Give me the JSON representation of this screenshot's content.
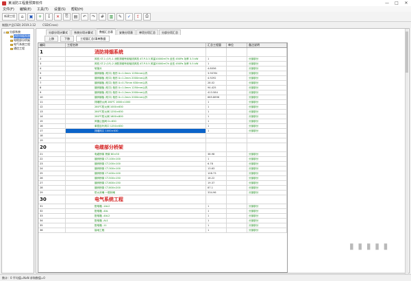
{
  "window": {
    "title": "某消防工程量预算软件",
    "controls": [
      "—",
      "□",
      "✕"
    ]
  },
  "menu": [
    "文件(F)",
    "编辑(E)",
    "工具(T)",
    "设置(S)",
    "帮助(H)"
  ],
  "toolbar": {
    "buttons": [
      {
        "name": "new-project-icon",
        "glyph": "新建工程",
        "cls": "wide"
      },
      {
        "name": "open-icon",
        "glyph": "⌂",
        "cls": ""
      },
      {
        "name": "save-icon",
        "glyph": "▣",
        "cls": "blue"
      },
      {
        "name": "add-row-icon",
        "glyph": "+",
        "cls": "green"
      },
      {
        "name": "insert-icon",
        "glyph": "↧",
        "cls": ""
      },
      {
        "name": "delete-icon",
        "glyph": "✕",
        "cls": "red"
      },
      {
        "name": "copy-icon",
        "glyph": "⎘",
        "cls": ""
      },
      {
        "name": "paste-icon",
        "glyph": "▤",
        "cls": ""
      },
      {
        "name": "undo-icon",
        "glyph": "↶",
        "cls": ""
      },
      {
        "name": "redo-icon",
        "glyph": "↷",
        "cls": ""
      },
      {
        "name": "calculator-icon",
        "glyph": "#",
        "cls": ""
      },
      {
        "name": "chart-icon",
        "glyph": "▥",
        "cls": "green"
      },
      {
        "name": "pencil-icon",
        "glyph": "✎",
        "cls": ""
      },
      {
        "name": "wrench-icon",
        "glyph": "✓",
        "cls": "blue"
      },
      {
        "name": "export-icon",
        "glyph": "⇪",
        "cls": "red"
      },
      {
        "name": "print-icon",
        "glyph": "⎙",
        "cls": ""
      }
    ]
  },
  "infobar": {
    "left": "制图(产品CSD) 2019.3.12",
    "right": "CSD(Cross)"
  },
  "sidebar": {
    "items": [
      {
        "label": "分部系统",
        "level": 0,
        "twist": "⊟",
        "selected": false
      },
      {
        "label": "消防排烟系统",
        "level": 1,
        "twist": "",
        "selected": true
      },
      {
        "label": "电缆部分桥架",
        "level": 1,
        "twist": "",
        "selected": false
      },
      {
        "label": "电气系统工程",
        "level": 1,
        "twist": "",
        "selected": false
      },
      {
        "label": "通信工程",
        "level": 1,
        "twist": "",
        "selected": false
      }
    ]
  },
  "tabs": [
    "分部分项计算式",
    "系统分项计算式",
    "数据汇总表",
    "安装分项表",
    "单项分项汇总",
    "分部分项汇总"
  ],
  "active_tab": 2,
  "subtabs": [
    "上移",
    "下移",
    "工程量汇总/清单数据"
  ],
  "grid": {
    "columns": [
      "编码",
      "工程名称",
      "汇总工程量",
      "单位",
      "备注说明"
    ],
    "rows": [
      {
        "type": "sec",
        "no": "1",
        "name": "消防排烟系统",
        "qty": "",
        "unit": "",
        "note": ""
      },
      {
        "type": "item",
        "no": "2",
        "name": "风机 ST-1 (1F)-1 消防排烟专用轴流风机 4T-P-3.3 风量10000m³/h 全压 450Pa 功率 3.3 kW",
        "qty": "1",
        "unit": "",
        "note": "分部部分"
      },
      {
        "type": "item",
        "no": "3",
        "name": "风机 ST-2 (1F)-2 消防排烟专用轴流风机 4T-P-5.5 风量20000m³/h 全压 450Pa 功率 5.5 kW",
        "qty": "1",
        "unit": "",
        "note": "分部部分"
      },
      {
        "type": "item",
        "no": "4",
        "name": "软接头",
        "qty": "4.8056",
        "unit": "",
        "note": "分部部分"
      },
      {
        "type": "item",
        "no": "5",
        "name": "镀锌钢板 (咬口) 矩形 δ=1.0mm 1250mm以内",
        "qty": "3.9076t",
        "unit": "",
        "note": "分部部分"
      },
      {
        "type": "item",
        "no": "6",
        "name": "镀锌钢板 (咬口) 矩形 δ=1.2mm 2000mm以内",
        "qty": "4.9292",
        "unit": "",
        "note": "分部部分"
      },
      {
        "type": "item",
        "no": "7",
        "name": "镀锌钢板 (咬口) 矩形 δ=0.75mm 630mm以内",
        "qty": "28.02",
        "unit": "",
        "note": "分部部分"
      },
      {
        "type": "item",
        "no": "8",
        "name": "镀锌钢板 (咬口) 矩形 δ=1.0mm 1250mm以内",
        "qty": "94.425",
        "unit": "",
        "note": "分部部分"
      },
      {
        "type": "item",
        "no": "9",
        "name": "镀锌钢板 (咬口) 矩形 δ=1.2mm 2000mm以内",
        "qty": "413.584",
        "unit": "",
        "note": "分部部分"
      },
      {
        "type": "item",
        "no": "10",
        "name": "镀锌钢板 (咬口) 矩形 δ=1.2mm 2000mm以外",
        "qty": "665.8896",
        "unit": "",
        "note": "分部部分"
      },
      {
        "type": "item",
        "no": "11",
        "name": "排烟防火阀 280℃ 1600×1000",
        "qty": "1",
        "unit": "",
        "note": "分部部分"
      },
      {
        "type": "item",
        "no": "12",
        "name": "280℃防火阀 1000×630",
        "qty": "1",
        "unit": "",
        "note": "分部部分"
      },
      {
        "type": "item",
        "no": "13",
        "name": "280℃防火阀 1250×630",
        "qty": "1",
        "unit": "",
        "note": "分部部分"
      },
      {
        "type": "item",
        "no": "14",
        "name": "280℃防火阀 1600×800",
        "qty": "1",
        "unit": "",
        "note": "分部部分"
      },
      {
        "type": "item",
        "no": "15",
        "name": "风管止回阀 D=630",
        "qty": "1",
        "unit": "",
        "note": "分部部分"
      },
      {
        "type": "item",
        "no": "16",
        "name": "单层百叶风口 1250×630",
        "qty": "1",
        "unit": "",
        "note": "分部部分"
      },
      {
        "type": "item",
        "no": "17",
        "name": "排烟风口 1000×630",
        "qty": "1",
        "unit": "",
        "note": "分部部分",
        "selected": true
      },
      {
        "type": "item",
        "no": "18",
        "name": "",
        "qty": "",
        "unit": "",
        "note": ""
      },
      {
        "type": "item",
        "no": "19",
        "name": "",
        "qty": "",
        "unit": "",
        "note": ""
      },
      {
        "type": "sec",
        "no": "20",
        "name": "电缆部分桥架",
        "qty": "",
        "unit": "",
        "note": ""
      },
      {
        "type": "item",
        "no": "21",
        "name": "电缆桥架 桥架 80×50",
        "qty": "38.98",
        "unit": "",
        "note": "分部部分"
      },
      {
        "type": "item",
        "no": "22",
        "name": "镀锌桥架 CT-100×100",
        "qty": "1",
        "unit": "",
        "note": "分部部分"
      },
      {
        "type": "item",
        "no": "23",
        "name": "镀锌桥架 CT-200×100",
        "qty": "6.78",
        "unit": "",
        "note": "分部部分"
      },
      {
        "type": "item",
        "no": "24",
        "name": "镀锌桥架 CT-300×100",
        "qty": "13.63",
        "unit": "",
        "note": "分部部分"
      },
      {
        "type": "item",
        "no": "25",
        "name": "镀锌桥架 CT-400×100",
        "qty": "108.73",
        "unit": "",
        "note": "分部部分"
      },
      {
        "type": "item",
        "no": "26",
        "name": "镀锌桥架 CT-500×150",
        "qty": "16.22",
        "unit": "",
        "note": "分部部分"
      },
      {
        "type": "item",
        "no": "27",
        "name": "镀锌桥架 CT-600×150",
        "qty": "19.37",
        "unit": "",
        "note": "分部部分"
      },
      {
        "type": "item",
        "no": "28",
        "name": "镀锌桥架 CT-800×200",
        "qty": "87.1",
        "unit": "",
        "note": "分部部分"
      },
      {
        "type": "item",
        "no": "29",
        "name": "防火封堵 一般封堵",
        "qty": "334.96",
        "unit": "",
        "note": "分部部分"
      },
      {
        "type": "sec",
        "no": "30",
        "name": "电气系统工程",
        "qty": "",
        "unit": "",
        "note": ""
      },
      {
        "type": "item",
        "no": "31",
        "name": "配电箱 -1AL2",
        "qty": "1",
        "unit": "",
        "note": "分部部分"
      },
      {
        "type": "item",
        "no": "32",
        "name": "配电箱 -4AL",
        "qty": "1",
        "unit": "",
        "note": "分部部分"
      },
      {
        "type": "item",
        "no": "33",
        "name": "配电箱 -4AL2",
        "qty": "1",
        "unit": "",
        "note": "分部部分"
      },
      {
        "type": "item",
        "no": "34",
        "name": "配电箱 -AL1",
        "qty": "1",
        "unit": "",
        "note": "分部部分"
      },
      {
        "type": "item",
        "no": "35",
        "name": "配电箱 -11",
        "qty": "1",
        "unit": "",
        "note": "分部部分"
      },
      {
        "type": "item",
        "no": "36",
        "name": "接地工程",
        "qty": "1",
        "unit": "",
        "note": "分部部分"
      }
    ]
  },
  "status": "数计：0 平均值=NaN 求和数值=0",
  "watermark": "▮ ▮ ▮ ▮ ▮"
}
